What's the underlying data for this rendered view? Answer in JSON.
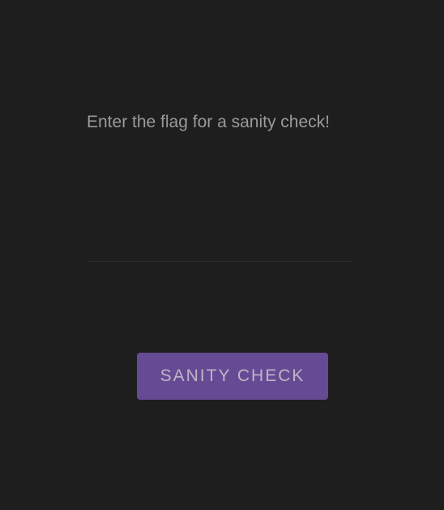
{
  "prompt": "Enter the flag for a sanity check!",
  "flag_input": {
    "value": "",
    "placeholder": ""
  },
  "button": {
    "label": "SANITY CHECK",
    "color": "#674a94"
  },
  "background_color": "#1f1e1f"
}
